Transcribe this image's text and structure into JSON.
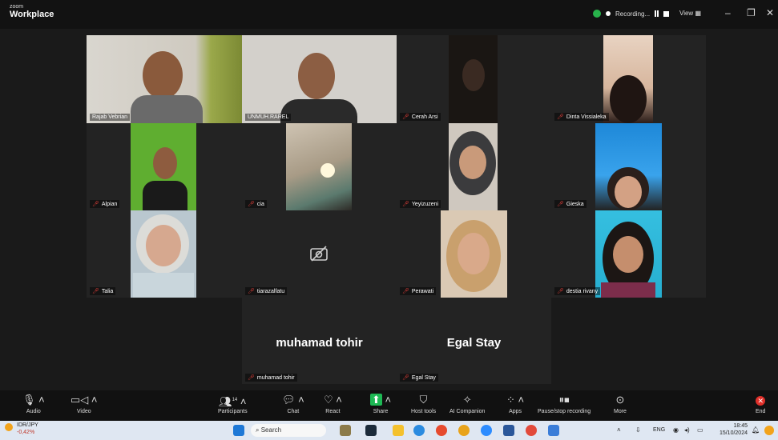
{
  "titlebar": {
    "brand_small": "zoom",
    "brand_big": "Workplace",
    "recording_label": "Recording...",
    "view_label": "View",
    "view_icon": "grid-icon",
    "minimize": "–",
    "restore": "❐",
    "close": "✕"
  },
  "participants": [
    {
      "name": "Rajab Vebrian",
      "muted": false
    },
    {
      "name": "UNMUH.RAREL",
      "muted": false
    },
    {
      "name": "Cerah Arsi",
      "muted": true
    },
    {
      "name": "Dinta Vissialeka",
      "muted": true
    },
    {
      "name": "Alpian",
      "muted": true
    },
    {
      "name": "cia",
      "muted": true
    },
    {
      "name": "Yeyizuzeni",
      "muted": true
    },
    {
      "name": "Gieska",
      "muted": true
    },
    {
      "name": "Talia",
      "muted": true
    },
    {
      "name": "tiarazalfatu",
      "muted": true
    },
    {
      "name": "Perawati",
      "muted": true
    },
    {
      "name": "destia rivany",
      "muted": true
    },
    {
      "name": "muhamad tohir",
      "muted": true
    },
    {
      "name": "Egal Stay",
      "muted": true
    }
  ],
  "camera_off_icon": "camera-off-icon",
  "toolbar": {
    "audio": "Audio",
    "video": "Video",
    "participants": "Participants",
    "participants_count": "14",
    "chat": "Chat",
    "react": "React",
    "share": "Share",
    "host_tools": "Host tools",
    "ai_companion": "AI Companion",
    "apps": "Apps",
    "pause_stop_recording": "Pause/stop recording",
    "more": "More",
    "end": "End"
  },
  "colors": {
    "muted_icon": "#e8403a",
    "active_speaker": "#4bd44b",
    "share_green": "#1db954",
    "end_red": "#e0302a"
  },
  "taskbar": {
    "ticker_name": "IDR/JPY",
    "ticker_change": "-0,42%",
    "search_placeholder": "Search",
    "language": "ENG",
    "time": "18:45",
    "date": "15/10/2024"
  }
}
